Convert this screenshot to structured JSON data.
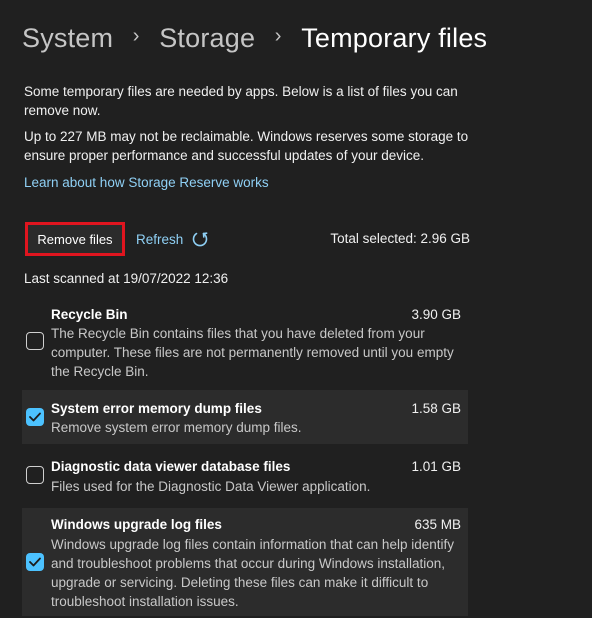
{
  "breadcrumb": {
    "items": [
      "System",
      "Storage",
      "Temporary files"
    ]
  },
  "intro": {
    "line1": "Some temporary files are needed by apps. Below is a list of files you can remove now.",
    "line2": "Up to 227 MB may not be reclaimable. Windows reserves some storage to ensure proper performance and successful updates of your device."
  },
  "learn_link": "Learn about how Storage Reserve works",
  "actions": {
    "remove_label": "Remove files",
    "refresh_label": "Refresh",
    "total_selected": "Total selected: 2.96 GB"
  },
  "last_scanned": "Last scanned at 19/07/2022 12:36",
  "items": [
    {
      "title": "Recycle Bin",
      "size": "3.90 GB",
      "description": "The Recycle Bin contains files that you have deleted from your computer. These files are not permanently removed until you empty the Recycle Bin.",
      "checked": false
    },
    {
      "title": "System error memory dump files",
      "size": "1.58 GB",
      "description": "Remove system error memory dump files.",
      "checked": true
    },
    {
      "title": "Diagnostic data viewer database files",
      "size": "1.01 GB",
      "description": "Files used for the Diagnostic Data Viewer application.",
      "checked": false
    },
    {
      "title": "Windows upgrade log files",
      "size": "635 MB",
      "description": "Windows upgrade log files contain information that can help identify and troubleshoot problems that occur during Windows installation, upgrade or servicing. Deleting these files can make it difficult to troubleshoot installation issues.",
      "checked": true
    }
  ],
  "colors": {
    "background": "#202020",
    "accent_link": "#8fd0f5",
    "checkbox_checked": "#4cc2ff",
    "highlight_border": "#e0151f"
  }
}
